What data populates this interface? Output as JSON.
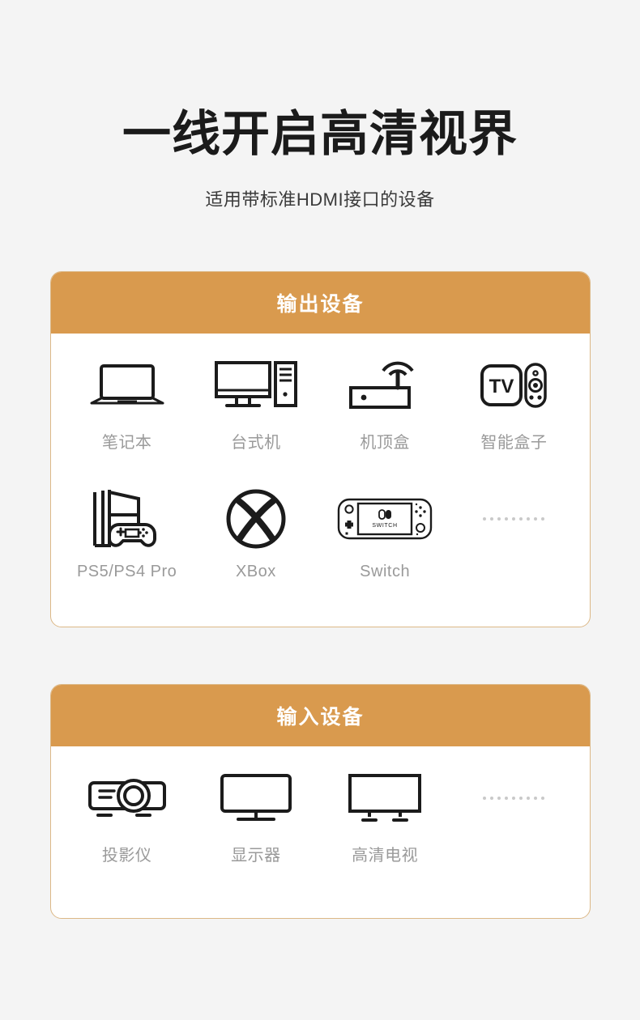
{
  "header": {
    "title": "一线开启高清视界",
    "subtitle": "适用带标准HDMI接口的设备"
  },
  "colors": {
    "background": "#f4f4f4",
    "card_background": "#ffffff",
    "card_border": "#dcb887",
    "header_band": "#d99a4e",
    "header_text": "#ffffff",
    "title_text": "#1b1b1b",
    "label_text": "#9a9a9a",
    "icon_stroke": "#1b1b1b",
    "dots": "#c9c9c9"
  },
  "cards": [
    {
      "id": "output",
      "title": "输出设备",
      "rows": [
        [
          {
            "label": "笔记本",
            "icon": "laptop-icon"
          },
          {
            "label": "台式机",
            "icon": "desktop-computer-icon"
          },
          {
            "label": "机顶盒",
            "icon": "set-top-box-icon"
          },
          {
            "label": "智能盒子",
            "icon": "smart-tv-box-icon"
          }
        ],
        [
          {
            "label": "PS5/PS4 Pro",
            "icon": "playstation-console-icon"
          },
          {
            "label": "XBox",
            "icon": "xbox-logo-icon"
          },
          {
            "label": "Switch",
            "icon": "nintendo-switch-icon"
          },
          {
            "label": "",
            "icon": "ellipsis-dots-icon"
          }
        ]
      ]
    },
    {
      "id": "input",
      "title": "输入设备",
      "rows": [
        [
          {
            "label": "投影仪",
            "icon": "projector-icon"
          },
          {
            "label": "显示器",
            "icon": "monitor-icon"
          },
          {
            "label": "高清电视",
            "icon": "hd-television-icon"
          },
          {
            "label": "",
            "icon": "ellipsis-dots-icon"
          }
        ]
      ]
    }
  ],
  "switch_screen_label": "SWITCH",
  "tv_box_label": "TV"
}
